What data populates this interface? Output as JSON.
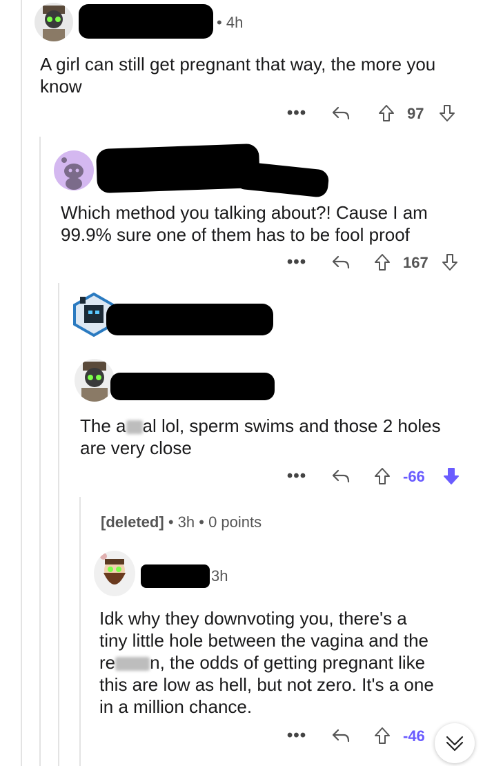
{
  "comments": [
    {
      "time": "4h",
      "text": "A girl can still get pregnant that way, the more you know",
      "score": "97"
    },
    {
      "text": "Which method you talking about?! Cause I am 99.9% sure one of them has to be fool proof",
      "score": "167"
    },
    {
      "text_before": "The a",
      "text_after": "al lol, sperm swims and those 2 holes are very close",
      "score": "-66"
    },
    {
      "author": "[deleted]",
      "time": "3h",
      "points": "0 points"
    },
    {
      "time": "3h",
      "text_line1": "Idk why they downvoting you, there's a",
      "text_line2": "tiny little hole between the vagina and the",
      "text_line3_before": "re",
      "text_line3_after": "n, the odds of getting pregnant like",
      "text_line4": "this are low as hell, but not zero. It's a one",
      "text_line5": "in a million chance.",
      "score": "-46"
    }
  ],
  "separator": "•",
  "icons": {
    "more": "more-dots-icon",
    "reply": "reply-arrow-icon",
    "upvote": "upvote-arrow-icon",
    "downvote": "downvote-arrow-icon",
    "scroll": "double-chevron-down-icon"
  },
  "colors": {
    "downvote_active": "#6a5cff"
  }
}
